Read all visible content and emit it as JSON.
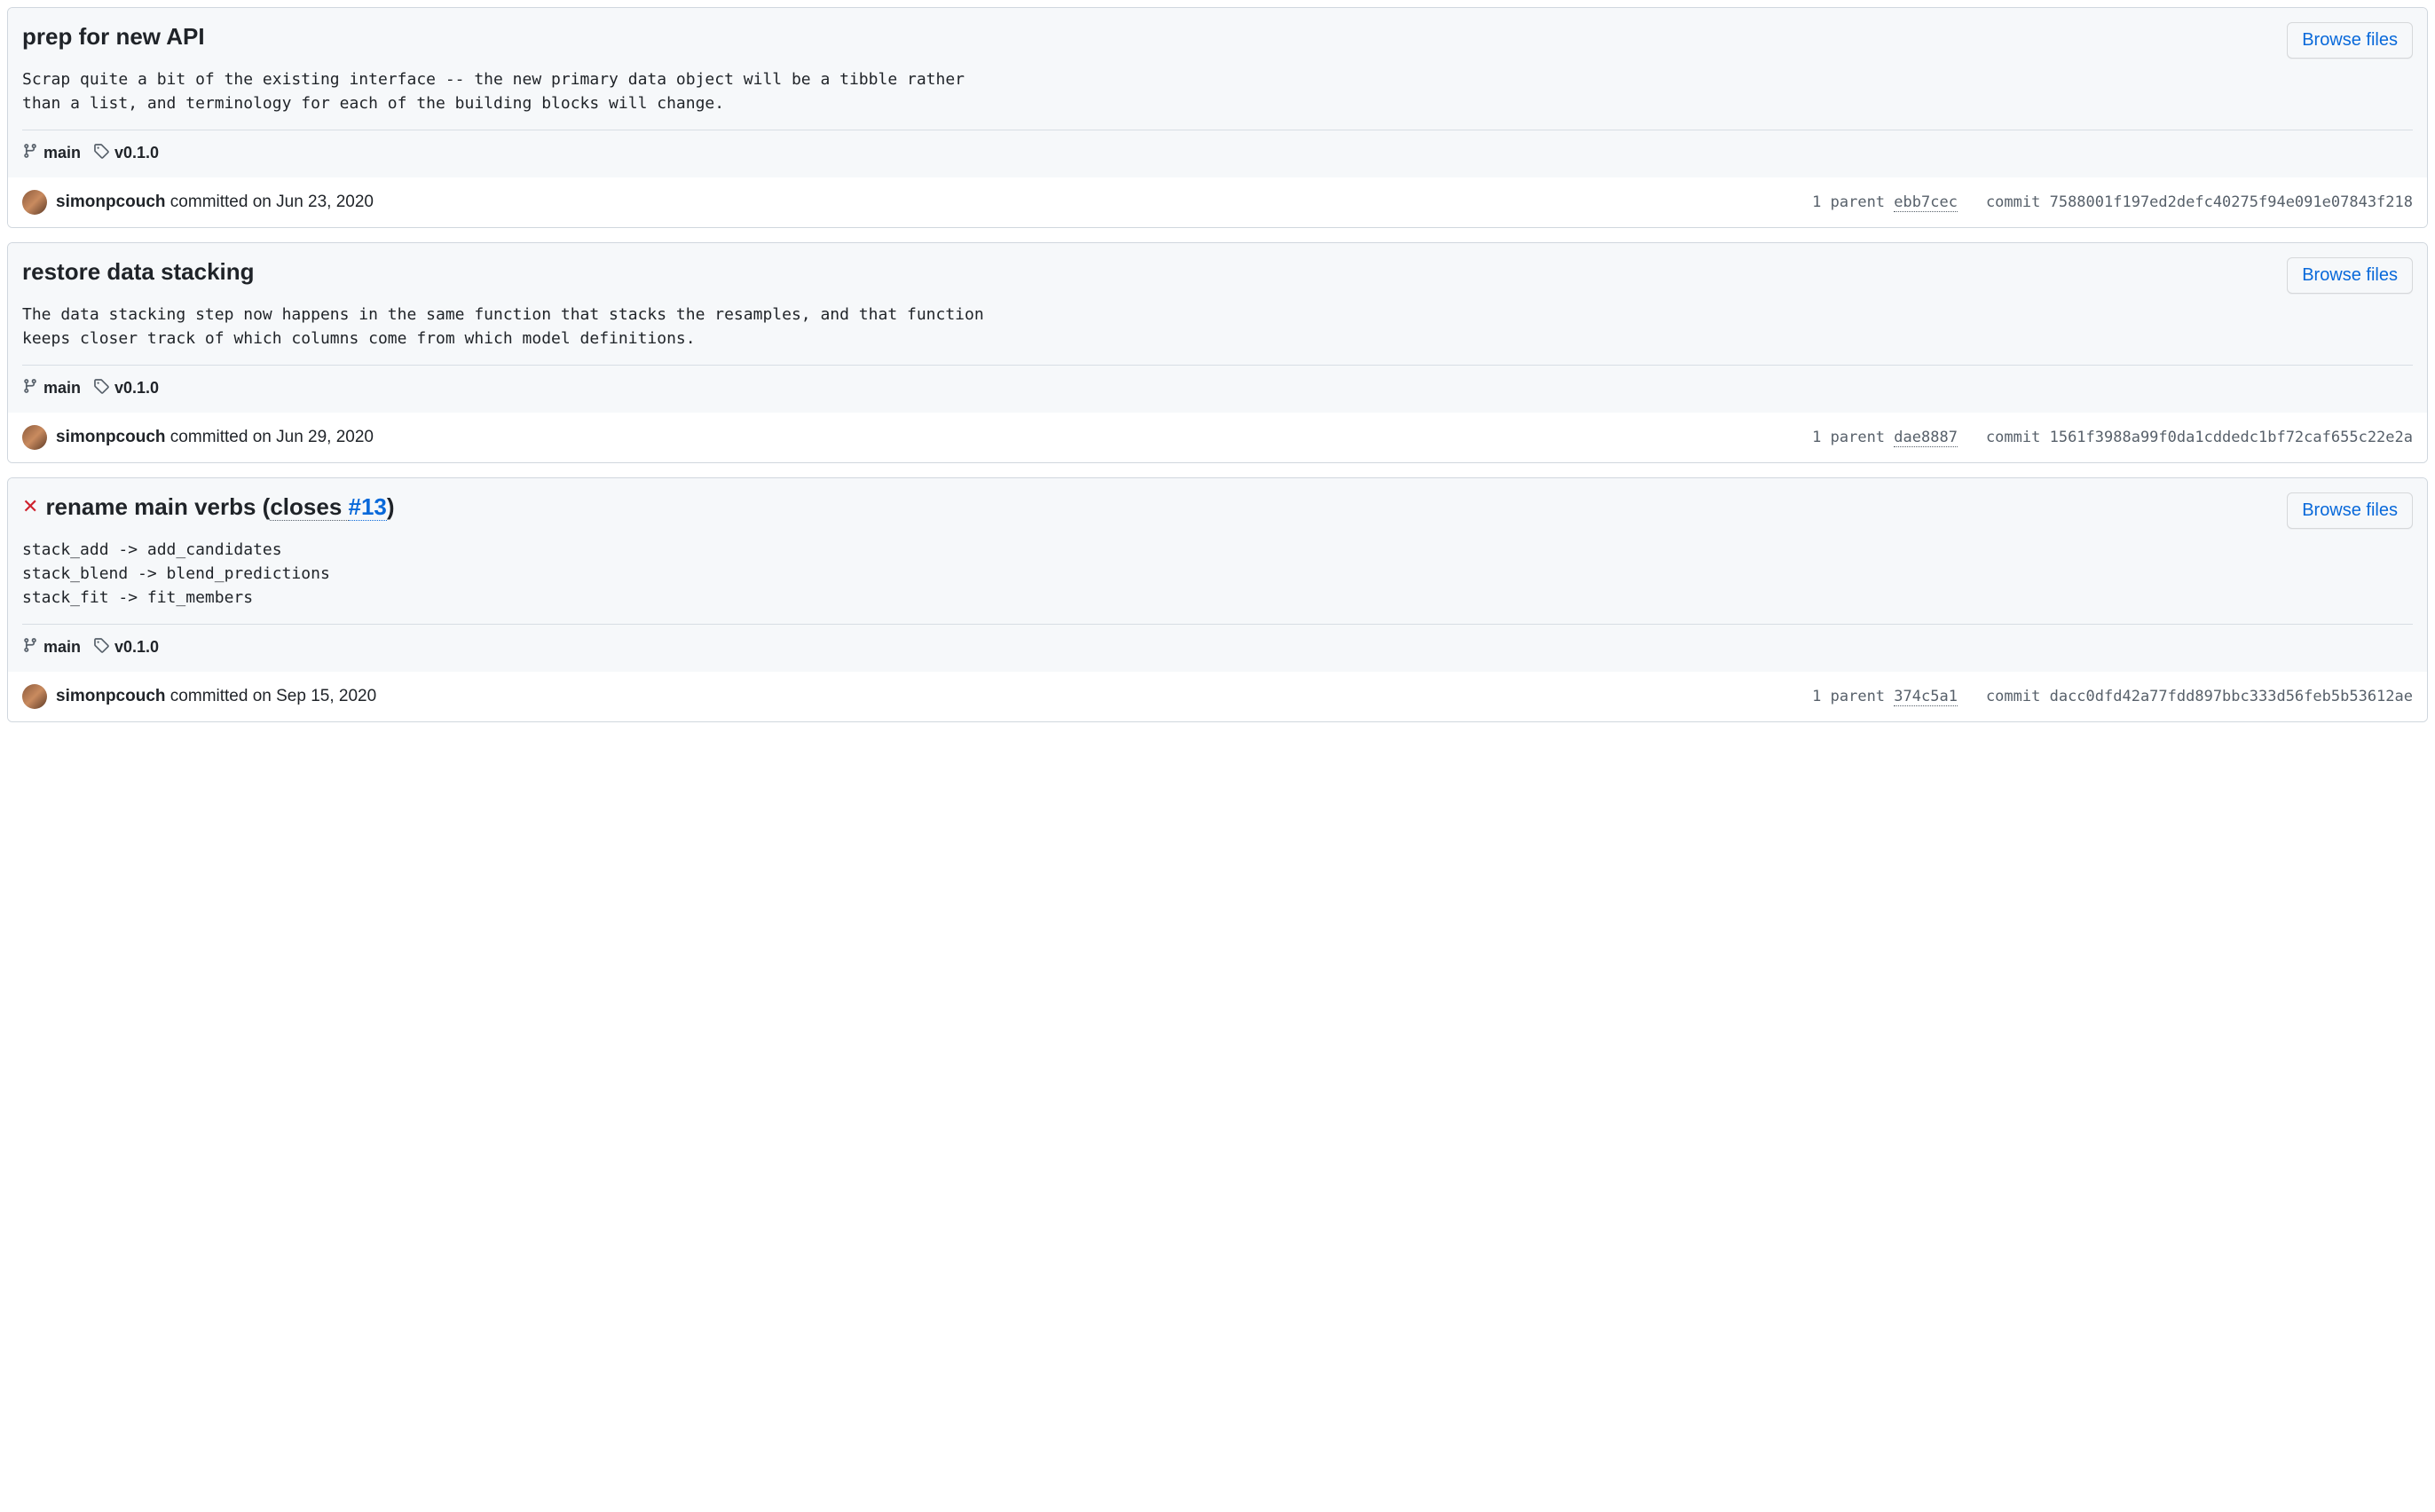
{
  "browse_files_label": "Browse files",
  "parent_label": "1 parent",
  "commit_label": "commit",
  "committed_on_label": "committed on",
  "commits": [
    {
      "title": "prep for new API",
      "status_x": false,
      "closes_issue": null,
      "description": "Scrap quite a bit of the existing interface -- the new primary data object will be a tibble rather\nthan a list, and terminology for each of the building blocks will change.",
      "branch": "main",
      "tag": "v0.1.0",
      "author": "simonpcouch",
      "date": "Jun 23, 2020",
      "parent_sha": "ebb7cec",
      "commit_sha": "7588001f197ed2defc40275f94e091e07843f218"
    },
    {
      "title": "restore data stacking",
      "status_x": false,
      "closes_issue": null,
      "description": "The data stacking step now happens in the same function that stacks the resamples, and that function\nkeeps closer track of which columns come from which model definitions.",
      "branch": "main",
      "tag": "v0.1.0",
      "author": "simonpcouch",
      "date": "Jun 29, 2020",
      "parent_sha": "dae8887",
      "commit_sha": "1561f3988a99f0da1cddedc1bf72caf655c22e2a"
    },
    {
      "title": "rename main verbs",
      "status_x": true,
      "closes_text": "closes",
      "closes_issue": "#13",
      "description": "stack_add -> add_candidates\nstack_blend -> blend_predictions\nstack_fit -> fit_members",
      "branch": "main",
      "tag": "v0.1.0",
      "author": "simonpcouch",
      "date": "Sep 15, 2020",
      "parent_sha": "374c5a1",
      "commit_sha": "dacc0dfd42a77fdd897bbc333d56feb5b53612ae"
    }
  ]
}
